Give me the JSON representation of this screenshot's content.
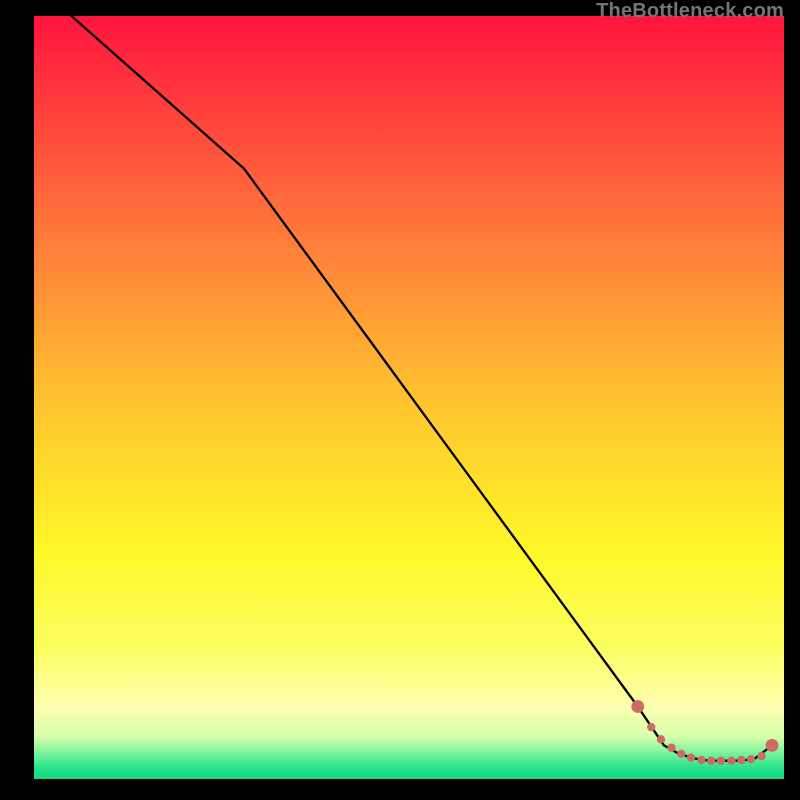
{
  "watermark": "TheBottleneck.com",
  "colors": {
    "page_bg": "#000000",
    "line": "#000000",
    "marker_fill": "#cf6a65",
    "gradient_stops": [
      {
        "offset": 0.0,
        "color": "#ff143e"
      },
      {
        "offset": 0.3,
        "color": "#ff7e3b"
      },
      {
        "offset": 0.5,
        "color": "#ffc22e"
      },
      {
        "offset": 0.7,
        "color": "#fff728"
      },
      {
        "offset": 0.83,
        "color": "#fbff60"
      },
      {
        "offset": 0.905,
        "color": "#fdffb0"
      },
      {
        "offset": 0.945,
        "color": "#d6ffab"
      },
      {
        "offset": 0.965,
        "color": "#7cf59d"
      },
      {
        "offset": 0.985,
        "color": "#29e48d"
      },
      {
        "offset": 1.0,
        "color": "#14d982"
      }
    ]
  },
  "chart_data": {
    "type": "line",
    "title": "",
    "xlabel": "",
    "ylabel": "",
    "xlim": [
      0,
      100
    ],
    "ylim": [
      0,
      100
    ],
    "grid": false,
    "legend": false,
    "series": [
      {
        "name": "curve",
        "style": "line",
        "x": [
          5.0,
          28.0,
          80.5,
          84.0,
          86.0,
          88.0,
          90.0,
          92.0,
          94.0,
          96.0,
          98.4
        ],
        "y": [
          100.0,
          80.0,
          9.5,
          4.4,
          3.3,
          2.7,
          2.4,
          2.4,
          2.4,
          2.6,
          4.4
        ]
      },
      {
        "name": "markers-small",
        "style": "scatter",
        "radius": 4.2,
        "x": [
          82.3,
          83.6,
          85.0,
          86.3,
          87.6,
          89.0,
          90.3,
          91.6,
          93.0,
          94.3,
          95.6,
          97.0
        ],
        "y": [
          6.8,
          5.2,
          4.1,
          3.3,
          2.8,
          2.5,
          2.4,
          2.4,
          2.4,
          2.5,
          2.6,
          3.0
        ]
      },
      {
        "name": "markers-large",
        "style": "scatter",
        "radius": 6.4,
        "x": [
          80.5,
          98.4
        ],
        "y": [
          9.5,
          4.4
        ]
      }
    ]
  }
}
